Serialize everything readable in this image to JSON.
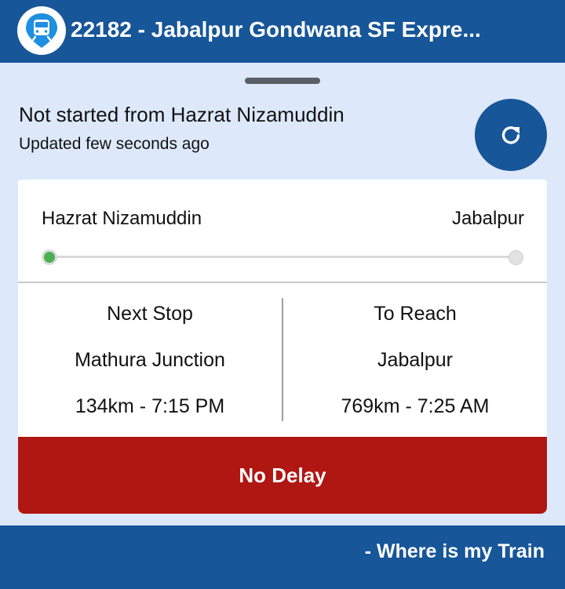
{
  "header": {
    "title": "22182 - Jabalpur Gondwana SF Expre...",
    "logo_icon": "train-pin-icon"
  },
  "status": {
    "title": "Not started from Hazrat Nizamuddin",
    "updated": "Updated few seconds ago",
    "refresh_icon": "refresh-icon"
  },
  "route": {
    "from": "Hazrat Nizamuddin",
    "to": "Jabalpur",
    "progress": 0
  },
  "next_stop": {
    "heading": "Next Stop",
    "station": "Mathura Junction",
    "detail": "134km - 7:15 PM"
  },
  "to_reach": {
    "heading": "To Reach",
    "station": "Jabalpur",
    "detail": "769km - 7:25 AM"
  },
  "delay": {
    "label": "No Delay"
  },
  "footer": {
    "credit": "- Where is my Train"
  },
  "colors": {
    "brand_blue": "#175698",
    "background": "#dde9fb",
    "delay_red": "#b01612",
    "start_green": "#4caf50"
  }
}
